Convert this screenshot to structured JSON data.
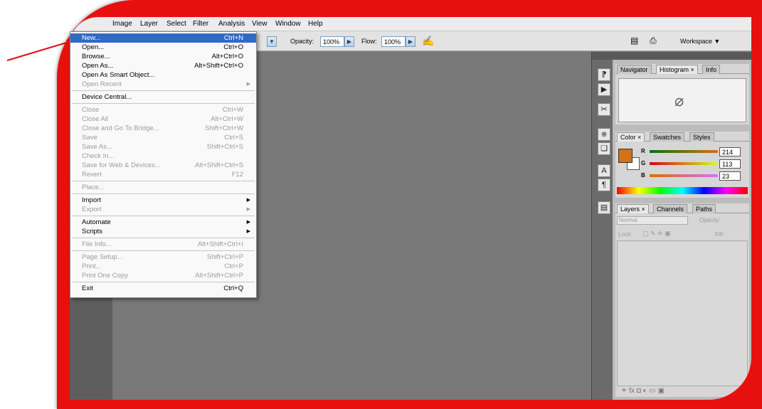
{
  "menubar": {
    "items": [
      "Image",
      "Layer",
      "Select",
      "Filter",
      "Analysis",
      "View",
      "Window",
      "Help"
    ]
  },
  "options": {
    "opacity_label": "Opacity:",
    "opacity_value": "100%",
    "flow_label": "Flow:",
    "flow_value": "100%",
    "workspace_label": "Workspace ▼"
  },
  "file_menu": {
    "items": [
      {
        "label": "New...",
        "shortcut": "Ctrl+N",
        "state": "highlighted"
      },
      {
        "label": "Open...",
        "shortcut": "Ctrl+O",
        "state": "enabled"
      },
      {
        "label": "Browse...",
        "shortcut": "Alt+Ctrl+O",
        "state": "enabled"
      },
      {
        "label": "Open As...",
        "shortcut": "Alt+Shift+Ctrl+O",
        "state": "enabled"
      },
      {
        "label": "Open As Smart Object...",
        "shortcut": "",
        "state": "enabled"
      },
      {
        "label": "Open Recent",
        "shortcut": "",
        "state": "disabled",
        "submenu": true
      },
      {
        "label": "Device Central...",
        "shortcut": "",
        "state": "enabled",
        "sep_before": true
      },
      {
        "label": "Close",
        "shortcut": "Ctrl+W",
        "state": "disabled",
        "sep_before": true
      },
      {
        "label": "Close All",
        "shortcut": "Alt+Ctrl+W",
        "state": "disabled"
      },
      {
        "label": "Close and Go To Bridge...",
        "shortcut": "Shift+Ctrl+W",
        "state": "disabled"
      },
      {
        "label": "Save",
        "shortcut": "Ctrl+S",
        "state": "disabled"
      },
      {
        "label": "Save As...",
        "shortcut": "Shift+Ctrl+S",
        "state": "disabled"
      },
      {
        "label": "Check In...",
        "shortcut": "",
        "state": "disabled"
      },
      {
        "label": "Save for Web & Devices...",
        "shortcut": "Alt+Shift+Ctrl+S",
        "state": "disabled"
      },
      {
        "label": "Revert",
        "shortcut": "F12",
        "state": "disabled"
      },
      {
        "label": "Place...",
        "shortcut": "",
        "state": "disabled",
        "sep_before": true
      },
      {
        "label": "Import",
        "shortcut": "",
        "state": "enabled",
        "submenu": true,
        "sep_before": true
      },
      {
        "label": "Export",
        "shortcut": "",
        "state": "disabled",
        "submenu": true
      },
      {
        "label": "Automate",
        "shortcut": "",
        "state": "enabled",
        "submenu": true,
        "sep_before": true
      },
      {
        "label": "Scripts",
        "shortcut": "",
        "state": "enabled",
        "submenu": true
      },
      {
        "label": "File Info...",
        "shortcut": "Alt+Shift+Ctrl+I",
        "state": "disabled",
        "sep_before": true
      },
      {
        "label": "Page Setup...",
        "shortcut": "Shift+Ctrl+P",
        "state": "disabled",
        "sep_before": true
      },
      {
        "label": "Print...",
        "shortcut": "Ctrl+P",
        "state": "disabled"
      },
      {
        "label": "Print One Copy",
        "shortcut": "Alt+Shift+Ctrl+P",
        "state": "disabled"
      },
      {
        "label": "Exit",
        "shortcut": "Ctrl+Q",
        "state": "enabled",
        "sep_before": true
      }
    ]
  },
  "panels": {
    "nav_tabs": [
      "Navigator",
      "Histogram ×",
      "Info"
    ],
    "color_tabs": [
      "Color ×",
      "Swatches",
      "Styles"
    ],
    "color": {
      "r": "214",
      "g": "113",
      "b": "23",
      "r_label": "R",
      "g_label": "G",
      "b_label": "B",
      "swatch": "#d67117"
    },
    "layers_tabs": [
      "Layers ×",
      "Channels",
      "Paths"
    ],
    "layers": {
      "blend": "Normal",
      "opacity_label": "Opacity:",
      "lock_label": "Lock:",
      "fill_label": "Fill:"
    }
  },
  "colors": {
    "frame": "#e80f0f",
    "highlight": "#316ac5",
    "arrow": "#e01010"
  }
}
